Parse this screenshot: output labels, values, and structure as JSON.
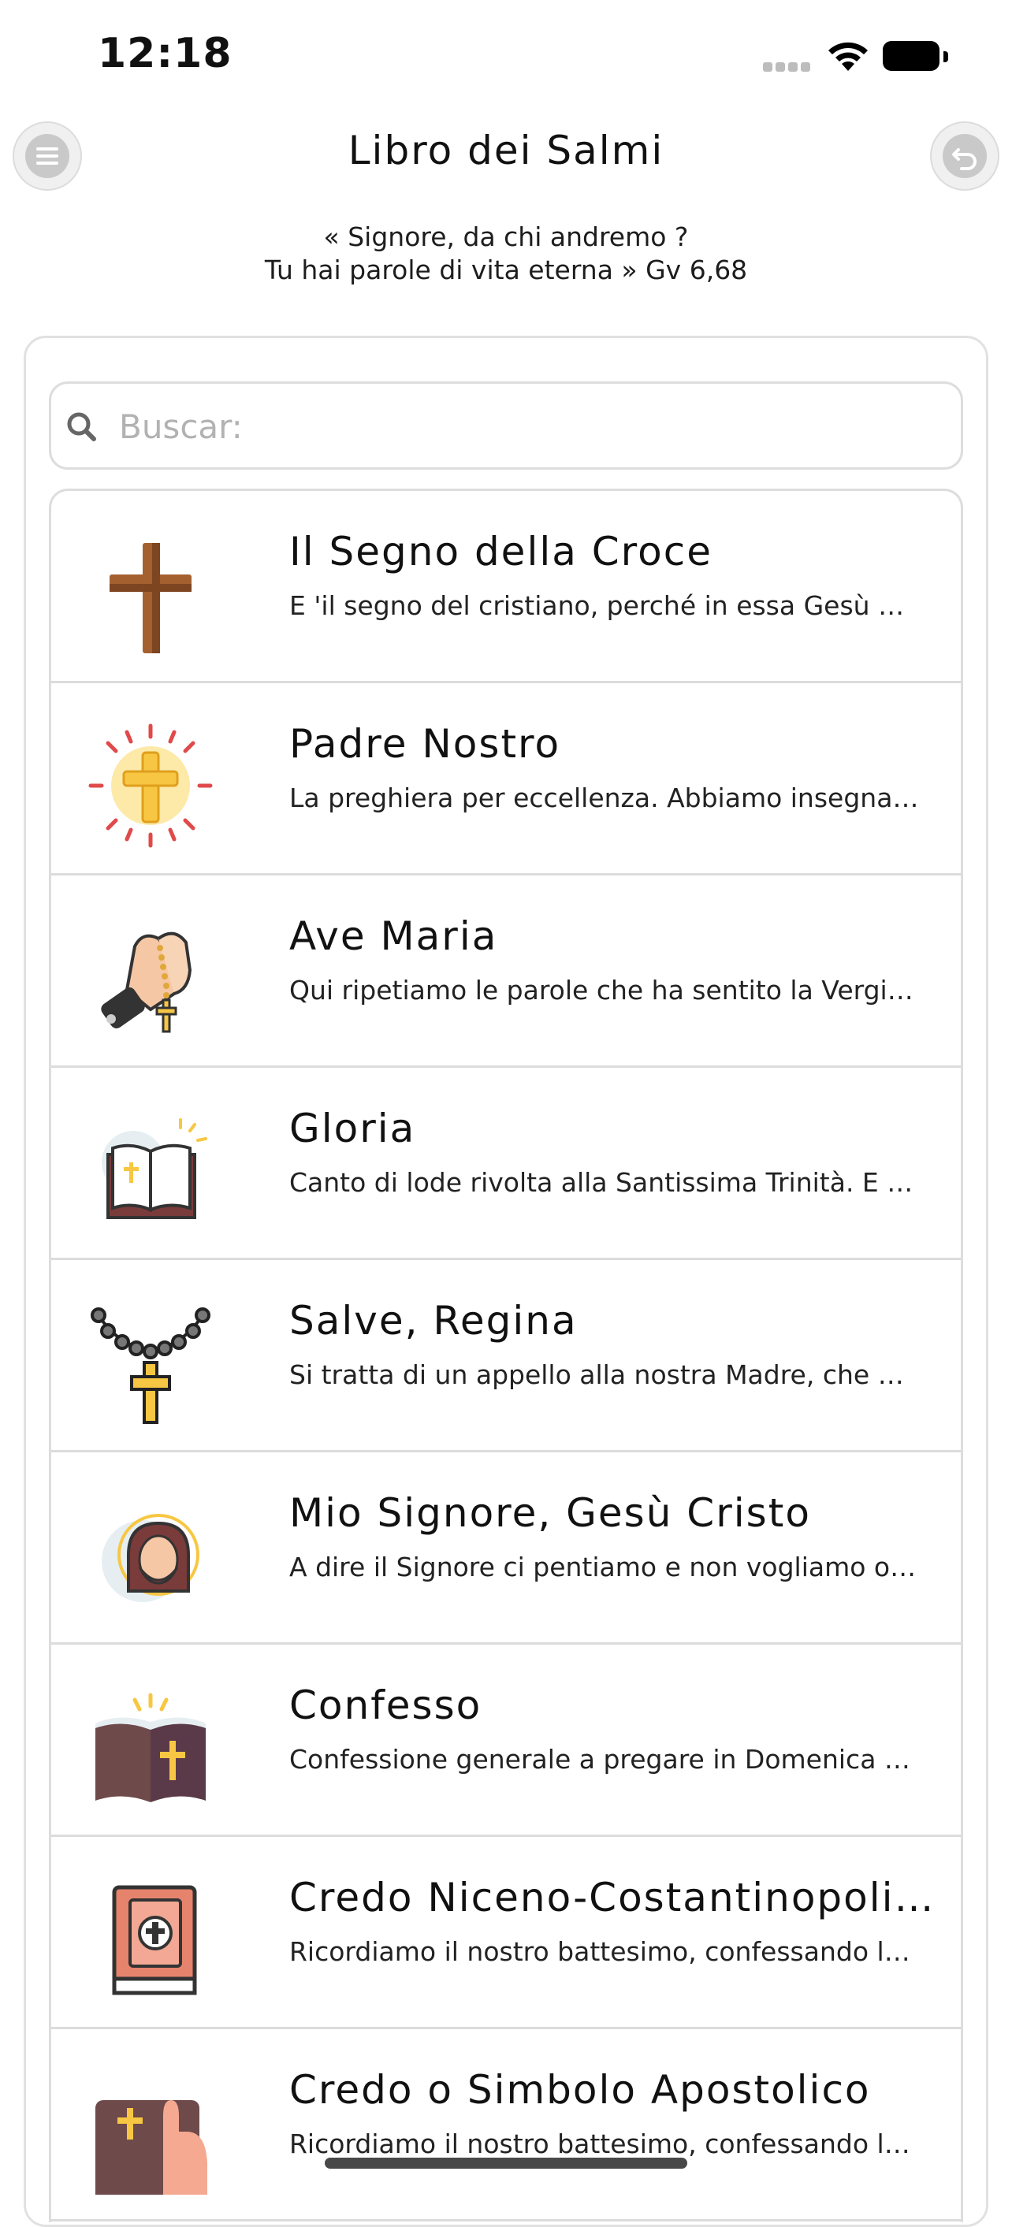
{
  "status_bar": {
    "time": "12:18"
  },
  "header": {
    "title": "Libro dei Salmi",
    "menu_icon": "hamburger-menu-icon",
    "back_icon": "undo-arrow-icon"
  },
  "quote": {
    "line1": "« Signore, da chi andremo ?",
    "line2": "Tu hai parole di vita eterna » Gv 6,68"
  },
  "search": {
    "placeholder": "Buscar:",
    "value": ""
  },
  "colors": {
    "divider": "#dcdcdc",
    "placeholder": "#b2b2b2",
    "accent_gold": "#f7c743"
  },
  "prayers": [
    {
      "title": "Il Segno della Croce",
      "subtitle": "E 'il segno del cristiano, perché in essa Gesù è morto per salvarci",
      "icon": "wooden-cross-icon"
    },
    {
      "title": "Padre Nostro",
      "subtitle": "La preghiera per eccellenza. Abbiamo insegnato Gesù stesso",
      "icon": "radiant-cross-icon"
    },
    {
      "title": "Ave Maria",
      "subtitle": "Qui ripetiamo le parole che ha sentito la Vergine Maria",
      "icon": "praying-hands-rosary-icon"
    },
    {
      "title": "Gloria",
      "subtitle": "Canto di lode rivolta alla Santissima Trinità. E 'una preghiera antica",
      "icon": "open-bible-icon"
    },
    {
      "title": "Salve, Regina",
      "subtitle": "Si tratta di un appello alla nostra Madre, che prega per noi",
      "icon": "rosary-icon"
    },
    {
      "title": "Mio Signore, Gesù Cristo",
      "subtitle": "A dire il Signore ci pentiamo e non vogliamo offenderlo più",
      "icon": "jesus-halo-icon"
    },
    {
      "title": "Confesso",
      "subtitle": "Confessione generale a pregare in Domenica e nella Messa",
      "icon": "holy-book-icon"
    },
    {
      "title": "Credo Niceno-Costantinopolitano",
      "subtitle": "Ricordiamo il nostro battesimo, confessando la nostra fede",
      "icon": "bible-cross-cover-icon"
    },
    {
      "title": "Credo o Simbolo Apostolico",
      "subtitle": "Ricordiamo il nostro battesimo, confessando la nostra fede",
      "icon": "hand-on-bible-icon"
    }
  ]
}
